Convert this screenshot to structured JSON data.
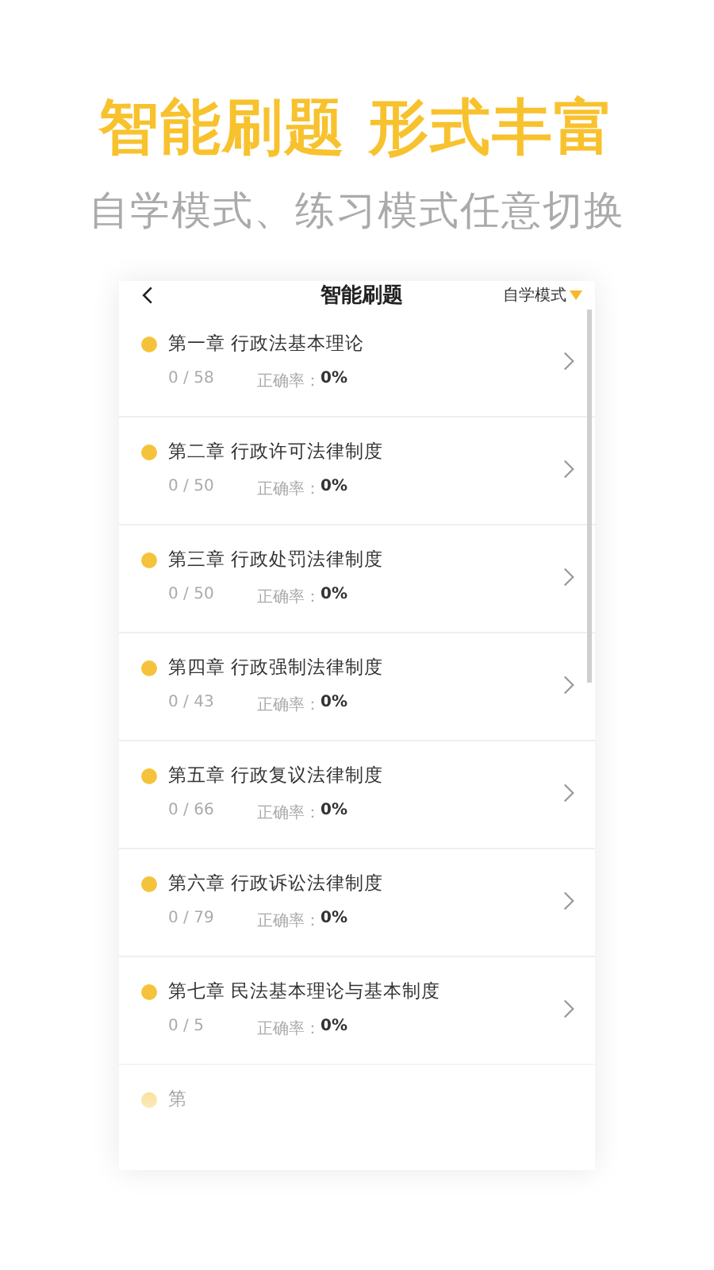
{
  "headline": "智能刷题 形式丰富",
  "subtitle": "自学模式、练习模式任意切换",
  "screen": {
    "title": "智能刷题",
    "mode": "自学模式",
    "chapters": [
      {
        "title": "第一章 行政法基本理论",
        "progress": "0 / 58",
        "accuracy_label": "正确率：",
        "accuracy": "0%"
      },
      {
        "title": "第二章 行政许可法律制度",
        "progress": "0 / 50",
        "accuracy_label": "正确率：",
        "accuracy": "0%"
      },
      {
        "title": "第三章 行政处罚法律制度",
        "progress": "0 / 50",
        "accuracy_label": "正确率：",
        "accuracy": "0%"
      },
      {
        "title": "第四章 行政强制法律制度",
        "progress": "0 / 43",
        "accuracy_label": "正确率：",
        "accuracy": "0%"
      },
      {
        "title": "第五章 行政复议法律制度",
        "progress": "0 / 66",
        "accuracy_label": "正确率：",
        "accuracy": "0%"
      },
      {
        "title": "第六章 行政诉讼法律制度",
        "progress": "0 / 79",
        "accuracy_label": "正确率：",
        "accuracy": "0%"
      },
      {
        "title": "第七章 民法基本理论与基本制度",
        "progress": "0 / 5",
        "accuracy_label": "正确率：",
        "accuracy": "0%"
      },
      {
        "title": "第"
      }
    ]
  }
}
